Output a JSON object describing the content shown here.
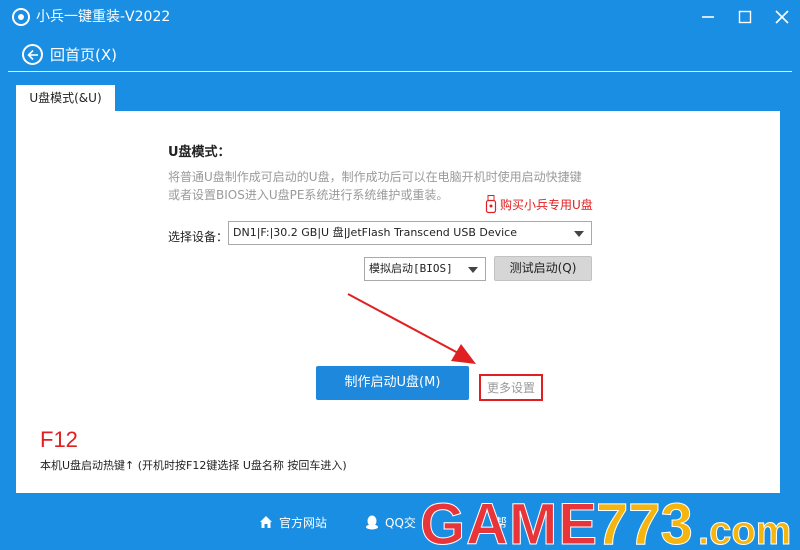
{
  "window": {
    "title": "小兵一键重装-V2022",
    "logo_icon": "soldier-logo-icon",
    "controls": [
      "minimize-icon",
      "maximize-icon",
      "close-icon"
    ]
  },
  "nav": {
    "back_label": "回首页(X)",
    "back_icon": "arrow-left-icon"
  },
  "tabs": [
    {
      "label": "U盘模式(&U)",
      "active": true
    }
  ],
  "main": {
    "heading": "U盘模式：",
    "description": [
      "将普通U盘制作成可启动的U盘，制作成功后可以在电脑开机时使用启动快捷键",
      "或者设置BIOS进入U盘PE系统进行系统维护或重装。"
    ],
    "buy_link": "购买小兵专用U盘",
    "device_label": "选择设备：",
    "device_value": "DN1|F:|30.2 GB|U 盘|JetFlash Transcend USB Device",
    "mode_value": "模拟启动[BIOS]",
    "test_button": "测试启动(Q)",
    "make_button": "制作启动U盘(M)",
    "more_settings": "更多设置",
    "hotkey": "F12",
    "hotkey_note": "本机U盘启动热键↑ (开机时按F12键选择 U盘名称 按回车进入)"
  },
  "footer": {
    "site": "官方网站",
    "qq": "QQ交",
    "help": "帮"
  },
  "watermark": "GAME773.com",
  "colors": {
    "brand_blue": "#1a8ee3",
    "button_blue": "#1e88dd",
    "highlight_red": "#e02020",
    "muted_text": "#9a9a9a"
  }
}
